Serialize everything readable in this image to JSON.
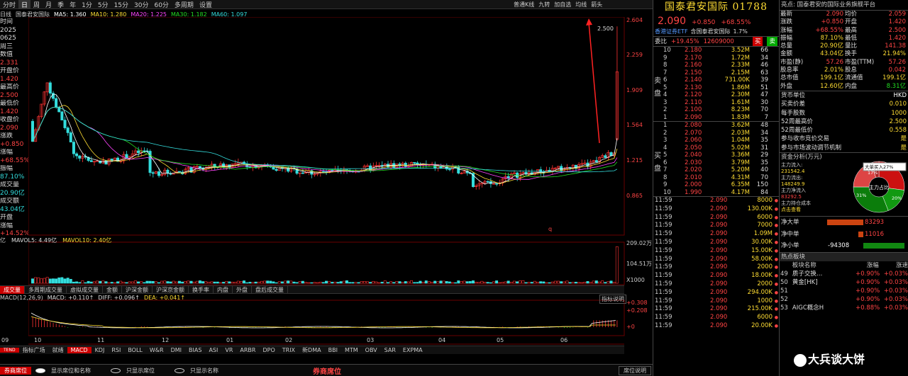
{
  "toolbar": {
    "items": [
      "分时",
      "日",
      "周",
      "月",
      "季",
      "年",
      "1分",
      "5分",
      "15分",
      "30分",
      "60分",
      "多周期",
      "设置"
    ],
    "selected": "日",
    "right": [
      "普通K线",
      "九转",
      "加自选",
      "均线",
      "箭头"
    ]
  },
  "legend": {
    "prefix": "日线",
    "name": "国泰君安国际",
    "ma": [
      {
        "label": "MA5: 1.360",
        "color": "#ffffff"
      },
      {
        "label": "MA10: 1.280",
        "color": "#ffdd33"
      },
      {
        "label": "MA20: 1.225",
        "color": "#ff44ff"
      },
      {
        "label": "MA30: 1.182",
        "color": "#22dd22"
      },
      {
        "label": "MA60: 1.097",
        "color": "#33dddd"
      }
    ]
  },
  "left_info": [
    [
      "时间",
      "w"
    ],
    [
      "2025",
      "w"
    ],
    [
      "0625",
      "w"
    ],
    [
      "周三",
      "w"
    ],
    [
      "数值",
      "w"
    ],
    [
      "2.331",
      "r"
    ],
    [
      "开盘价",
      "w"
    ],
    [
      "1.420",
      "r"
    ],
    [
      "最高价",
      "w"
    ],
    [
      "2.500",
      "r"
    ],
    [
      "最低价",
      "w"
    ],
    [
      "1.420",
      "r"
    ],
    [
      "收盘价",
      "w"
    ],
    [
      "2.090",
      "r"
    ],
    [
      "涨跌",
      "w"
    ],
    [
      "+0.850",
      "r"
    ],
    [
      "涨幅",
      "w"
    ],
    [
      "+68.55%",
      "r"
    ],
    [
      "振幅",
      "w"
    ],
    [
      "87.10%",
      "c"
    ],
    [
      "成交量",
      "w"
    ],
    [
      "20.90亿",
      "c"
    ],
    [
      "成交额",
      "w"
    ],
    [
      "43.04亿",
      "c"
    ],
    [
      "开盘",
      "w"
    ],
    [
      "涨幅",
      "w"
    ],
    [
      "+14.52%",
      "r"
    ]
  ],
  "price_axis": [
    "2.604",
    "2.259",
    "1.909",
    "1.564",
    "1.215",
    "0.865"
  ],
  "high_marker": "2.500",
  "low_marker": "q",
  "vol_legend": {
    "prefix": "亿",
    "mavol5": "MAVOL5: 4.49亿",
    "mavol10": "MAVOL10: 2.40亿"
  },
  "vol_axis": [
    "209.02万",
    "104.51万",
    "X1000"
  ],
  "ind_tabs": [
    "成交量",
    "多周期成交量",
    "虚拟成交量",
    "金额",
    "沪深金额",
    "沪深京金额",
    "换手率",
    "内盘",
    "外盘",
    "盘后成交量"
  ],
  "macd": {
    "label": "MACD(12,26,9)",
    "macd": "MACD: +0.110↑",
    "diff": "DIFF: +0.096↑",
    "dea": "DEA: +0.041↑",
    "btn": "指标说明"
  },
  "macd_axis": [
    "+0.308",
    "+0.208",
    "+0"
  ],
  "months": [
    "09",
    "10",
    "11",
    "12",
    "01",
    "02",
    "03",
    "04",
    "05",
    "06"
  ],
  "ind_tabs2": [
    "就绪",
    "MACD",
    "KDJ",
    "RSI",
    "BOLL",
    "W&R",
    "DMI",
    "BIAS",
    "ASI",
    "VR",
    "ARBR",
    "DPO",
    "TRIX",
    "新DMA",
    "BBI",
    "MTM",
    "OBV",
    "SAR",
    "EXPMA"
  ],
  "ind_tabs2_sel": "MACD",
  "ind_tabs2_prefix": [
    "",
    "TEND",
    "指标广场"
  ],
  "bottom": {
    "left": "券商席位",
    "opts": [
      "显示席位和名称",
      "只显示席位",
      "只显示名称"
    ],
    "title": "券商席位",
    "right": "席位说明"
  },
  "quote": {
    "title": "国泰君安国际 01788",
    "price": "2.090",
    "chg": "+0.850",
    "pct": "+68.55%",
    "etf": "香港证券ETF",
    "etf_val": "含国泰君安国际",
    "etf_pct": "1.7%",
    "ratio_label": "委比",
    "ratio": "+19.45%",
    "ratio_val": "12609000",
    "buy": "买",
    "sell": "卖",
    "sell_label": "卖盘",
    "buy_label": "买盘"
  },
  "asks": [
    [
      "10",
      "2.180",
      "3.52M",
      "66"
    ],
    [
      "9",
      "2.170",
      "1.72M",
      "34"
    ],
    [
      "8",
      "2.160",
      "2.33M",
      "46"
    ],
    [
      "7",
      "2.150",
      "2.15M",
      "63"
    ],
    [
      "6",
      "2.140",
      "731.00K",
      "39"
    ],
    [
      "5",
      "2.130",
      "1.86M",
      "51"
    ],
    [
      "4",
      "2.120",
      "2.30M",
      "47"
    ],
    [
      "3",
      "2.110",
      "1.61M",
      "30"
    ],
    [
      "2",
      "2.100",
      "8.23M",
      "70"
    ],
    [
      "1",
      "2.090",
      "1.83M",
      "7"
    ]
  ],
  "bids": [
    [
      "1",
      "2.080",
      "3.62M",
      "48"
    ],
    [
      "2",
      "2.070",
      "2.03M",
      "34"
    ],
    [
      "3",
      "2.060",
      "1.04M",
      "35"
    ],
    [
      "4",
      "2.050",
      "5.02M",
      "31"
    ],
    [
      "5",
      "2.040",
      "3.36M",
      "29"
    ],
    [
      "6",
      "2.030",
      "3.79M",
      "35"
    ],
    [
      "7",
      "2.020",
      "5.20M",
      "40"
    ],
    [
      "8",
      "2.010",
      "4.31M",
      "70"
    ],
    [
      "9",
      "2.000",
      "6.35M",
      "150"
    ],
    [
      "10",
      "1.990",
      "4.17M",
      "84"
    ]
  ],
  "ticks": [
    [
      "11:59",
      "2.090",
      "8000"
    ],
    [
      "11:59",
      "2.090",
      "130.00K"
    ],
    [
      "11:59",
      "2.090",
      "6000"
    ],
    [
      "11:59",
      "2.090",
      "7000"
    ],
    [
      "11:59",
      "2.090",
      "1.09M"
    ],
    [
      "11:59",
      "2.090",
      "30.00K"
    ],
    [
      "11:59",
      "2.090",
      "15.00K"
    ],
    [
      "11:59",
      "2.090",
      "58.00K"
    ],
    [
      "11:59",
      "2.090",
      "2000"
    ],
    [
      "11:59",
      "2.090",
      "18.00K"
    ],
    [
      "11:59",
      "2.090",
      "2000"
    ],
    [
      "11:59",
      "2.090",
      "294.00K"
    ],
    [
      "11:59",
      "2.090",
      "1000"
    ],
    [
      "11:59",
      "2.090",
      "215.00K"
    ],
    [
      "11:59",
      "2.090",
      "6000"
    ],
    [
      "11:59",
      "2.090",
      "20.00K"
    ]
  ],
  "tick_arrows": [
    "●",
    "●",
    "●",
    "●",
    "●",
    "●",
    "●",
    "●",
    "●",
    "●",
    "●",
    "●",
    "●",
    "●",
    "●",
    "●"
  ],
  "fund": {
    "header": "亮点: 国泰君安的国际业务旗舰平台",
    "grid": [
      [
        "最新",
        "2.090",
        "均价",
        "2.059"
      ],
      [
        "涨跌",
        "+0.850",
        "开盘",
        "1.420"
      ],
      [
        "涨幅",
        "+68.55%",
        "最高",
        "2.500"
      ],
      [
        "振幅",
        "87.10%",
        "最低",
        "1.420"
      ],
      [
        "总量",
        "20.90亿",
        "量比",
        "141.38"
      ],
      [
        "金额",
        "43.04亿",
        "换手",
        "21.94%"
      ],
      [
        "市盈(静)",
        "57.26",
        "市盈(TTM)",
        "57.26"
      ],
      [
        "股息率",
        "2.01%",
        "股息",
        "0.042"
      ],
      [
        "总市值",
        "199.1亿",
        "流通值",
        "199.1亿"
      ],
      [
        "外盘",
        "12.60亿",
        "内盘",
        "8.31亿"
      ]
    ],
    "info": [
      [
        "货币单位",
        "HKD"
      ],
      [
        "买卖价差",
        "0.010"
      ],
      [
        "每手股数",
        "1000"
      ],
      [
        "52周最高价",
        "2.500"
      ],
      [
        "52周最低价",
        "0.558"
      ],
      [
        "参与收市竞价交易",
        "是"
      ],
      [
        "参与市场波动调节机制",
        "是"
      ]
    ],
    "flow_title": "资金分析(万元)",
    "flow_lines": [
      "主力流入:",
      "231542.4",
      "主力流出:",
      "148249.9",
      "主力净流入",
      "83292.5",
      "主力持仓成本",
      "点击查看"
    ],
    "pie_center": "主力占比",
    "pie_labels": [
      "17%",
      "31%",
      "20%"
    ],
    "pie_tip": "大单买入27%",
    "net": [
      [
        "净大单",
        "83293"
      ],
      [
        "净中单",
        "11016"
      ],
      [
        "净小单",
        "-94308"
      ]
    ],
    "board_title": "热点板块",
    "board_head": [
      "板块名称",
      "涨幅",
      "涨速"
    ],
    "boards": [
      [
        "49",
        "质子交换…",
        "+0.90%",
        "+0.03%"
      ],
      [
        "50",
        "黄金[HK]",
        "+0.90%",
        "+0.03%"
      ],
      [
        "51",
        "",
        "+0.90%",
        "+0.03%"
      ],
      [
        "52",
        "",
        "+0.90%",
        "+0.03%"
      ],
      [
        "53",
        "AIGC概念H",
        "+0.88%",
        "+0.03%"
      ]
    ],
    "watermark": "大兵谈大饼"
  }
}
